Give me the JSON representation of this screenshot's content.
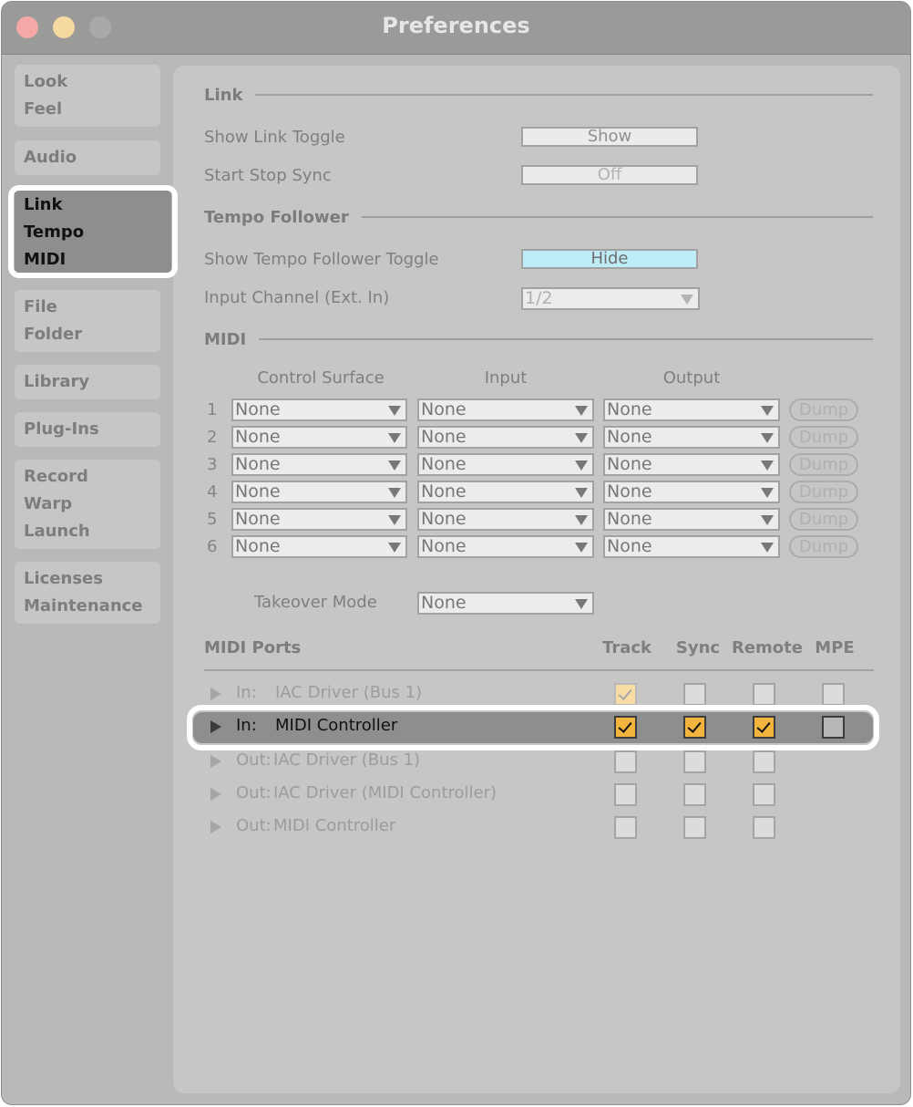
{
  "window": {
    "title": "Preferences"
  },
  "traffic_lights": {
    "close": "close",
    "minimize": "minimize",
    "zoom": "zoom"
  },
  "sidebar": {
    "groups": [
      {
        "items": [
          "Look",
          "Feel"
        ],
        "selected": false
      },
      {
        "items": [
          "Audio"
        ],
        "selected": false
      },
      {
        "items": [
          "Link",
          "Tempo",
          "MIDI"
        ],
        "selected": true
      },
      {
        "items": [
          "File",
          "Folder"
        ],
        "selected": false
      },
      {
        "items": [
          "Library"
        ],
        "selected": false
      },
      {
        "items": [
          "Plug-Ins"
        ],
        "selected": false
      },
      {
        "items": [
          "Record",
          "Warp",
          "Launch"
        ],
        "selected": false
      },
      {
        "items": [
          "Licenses",
          "Maintenance"
        ],
        "selected": false
      }
    ]
  },
  "link": {
    "heading": "Link",
    "show_link_toggle": {
      "label": "Show Link Toggle",
      "value": "Show"
    },
    "start_stop_sync": {
      "label": "Start Stop Sync",
      "value": "Off"
    }
  },
  "tempo_follower": {
    "heading": "Tempo Follower",
    "show_toggle": {
      "label": "Show Tempo Follower Toggle",
      "value": "Hide"
    },
    "input_channel": {
      "label": "Input Channel (Ext. In)",
      "value": "1/2"
    }
  },
  "midi": {
    "heading": "MIDI",
    "columns": {
      "control_surface": "Control Surface",
      "input": "Input",
      "output": "Output"
    },
    "dump_label": "Dump",
    "rows": [
      {
        "num": "1",
        "control_surface": "None",
        "input": "None",
        "output": "None"
      },
      {
        "num": "2",
        "control_surface": "None",
        "input": "None",
        "output": "None"
      },
      {
        "num": "3",
        "control_surface": "None",
        "input": "None",
        "output": "None"
      },
      {
        "num": "4",
        "control_surface": "None",
        "input": "None",
        "output": "None"
      },
      {
        "num": "5",
        "control_surface": "None",
        "input": "None",
        "output": "None"
      },
      {
        "num": "6",
        "control_surface": "None",
        "input": "None",
        "output": "None"
      }
    ],
    "takeover_mode": {
      "label": "Takeover Mode",
      "value": "None"
    }
  },
  "midi_ports": {
    "heading": "MIDI Ports",
    "columns": [
      "Track",
      "Sync",
      "Remote",
      "MPE"
    ],
    "ports": [
      {
        "dir": "In:",
        "name": "IAC Driver (Bus 1)",
        "selected": false,
        "track": "checked-dim",
        "sync": "off",
        "remote": "off",
        "mpe": "off"
      },
      {
        "dir": "In:",
        "name": "MIDI Controller",
        "selected": true,
        "track": "checked",
        "sync": "checked",
        "remote": "checked",
        "mpe": "off"
      },
      {
        "dir": "Out:",
        "name": "IAC Driver (Bus 1)",
        "selected": false,
        "track": "off",
        "sync": "off",
        "remote": "off",
        "mpe": null
      },
      {
        "dir": "Out:",
        "name": "IAC Driver (MIDI Controller)",
        "selected": false,
        "track": "off",
        "sync": "off",
        "remote": "off",
        "mpe": null
      },
      {
        "dir": "Out:",
        "name": "MIDI Controller",
        "selected": false,
        "track": "off",
        "sync": "off",
        "remote": "off",
        "mpe": null
      }
    ]
  },
  "colors": {
    "accent_checked": "#f3b43e",
    "toggle_on": "#bdebf6",
    "selection": "#8e8e8e"
  }
}
